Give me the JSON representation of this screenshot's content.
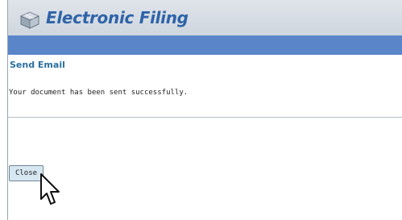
{
  "app": {
    "title": "Electronic Filing",
    "logo_icon": "ef-cube-logo-icon"
  },
  "page": {
    "section_title": "Send Email",
    "message": "Your document has been sent successfully."
  },
  "actions": {
    "close_label": "Close"
  },
  "cursor": {
    "icon": "mouse-pointer-icon"
  },
  "colors": {
    "header_title": "#2e63a8",
    "bar": "#5a86c9",
    "section_title": "#2a6fa0",
    "button_bg": "#d7e7f2"
  }
}
